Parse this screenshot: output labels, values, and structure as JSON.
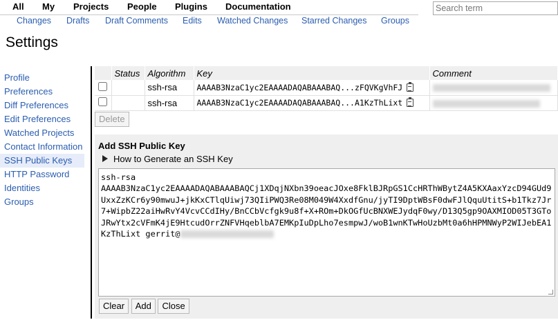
{
  "top_nav": [
    "All",
    "My",
    "Projects",
    "People",
    "Plugins",
    "Documentation"
  ],
  "sub_nav": [
    "Changes",
    "Drafts",
    "Draft Comments",
    "Edits",
    "Watched Changes",
    "Starred Changes",
    "Groups"
  ],
  "search": {
    "placeholder": "Search term"
  },
  "page_title": "Settings",
  "sidebar": {
    "items": [
      "Profile",
      "Preferences",
      "Diff Preferences",
      "Edit Preferences",
      "Watched Projects",
      "Contact Information",
      "SSH Public Keys",
      "HTTP Password",
      "Identities",
      "Groups"
    ],
    "active": "SSH Public Keys"
  },
  "keys_table": {
    "headers": [
      "Status",
      "Algorithm",
      "Key",
      "Comment"
    ],
    "rows": [
      {
        "algorithm": "ssh-rsa",
        "key": "AAAAB3NzaC1yc2EAAAADAQABAAABAQ...zFQVKgVhFJ"
      },
      {
        "algorithm": "ssh-rsa",
        "key": "AAAAB3NzaC1yc2EAAAADAQABAAABAQ...A1KzThLixt"
      }
    ],
    "delete_label": "Delete"
  },
  "add_key": {
    "title": "Add SSH Public Key",
    "howto": "How to Generate an SSH Key",
    "value": "ssh-rsa\nAAAAB3NzaC1yc2EAAAADAQABAAABAQCj1XDqjNXbn39oeacJOxe8FklBJRpGS1CcHRThWBytZ4A5KXAaxYzcD94GUd9UxxZzKCr6y90mwuJ+jkKxCTlqUiwj73QIiPWQ3Re08M049W4XxdfGnu/jyTI9DptWBsF0dwFJlQquUtitS+b1Tkz7Jr7+WipbZ22aiHwRvY4VcvCCdIHy/BnCCbVcfgk9u8f+X+ROm+DkOGfUcBNXWEJydqF0wy/D13Q5gp9OAXMIOD05T3GToJRwYtx2cVFmK4jE9HtcudOrrZNFVHqeblbA7EMKpIuDpLho7esmpwJ/woB1wnKTwHoUzbMt0a6hHPMNWyP2WIJebEA1KzThLixt gerrit@",
    "buttons": {
      "clear": "Clear",
      "add": "Add",
      "close": "Close"
    }
  }
}
